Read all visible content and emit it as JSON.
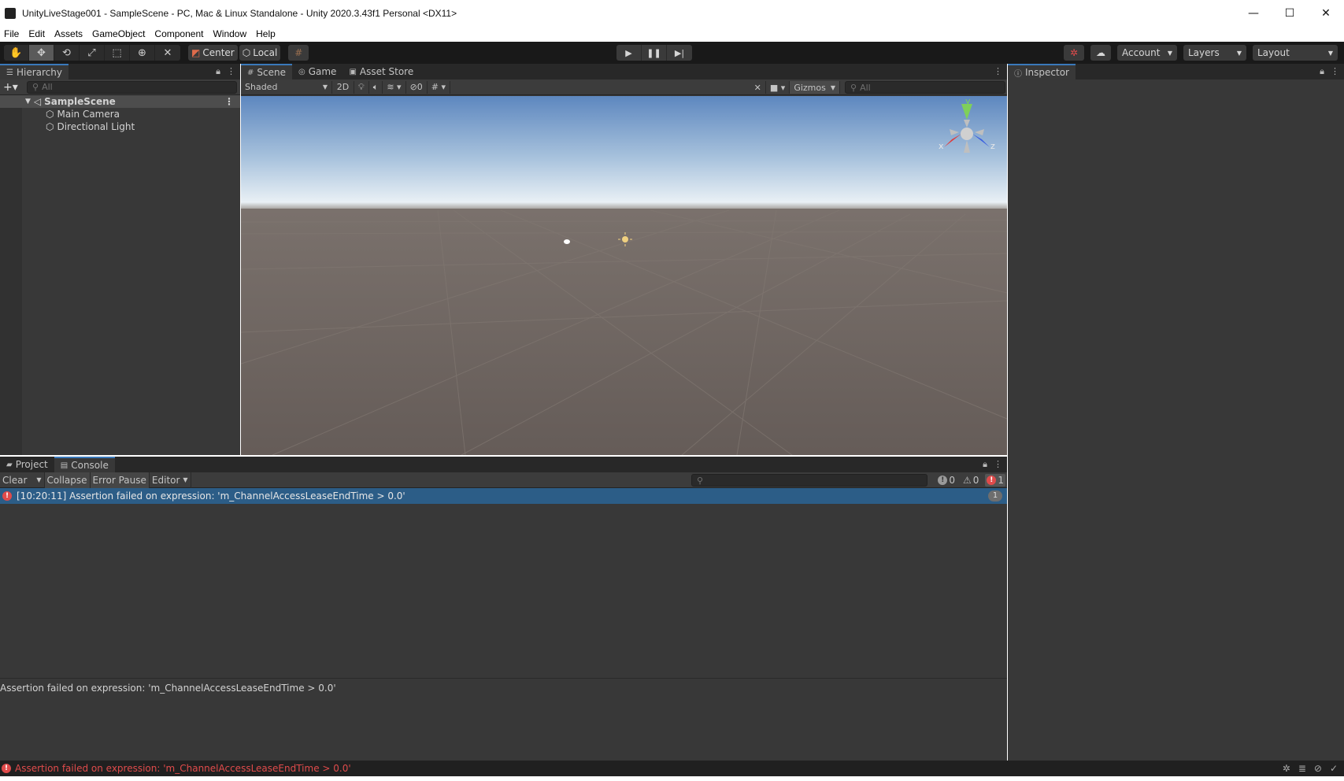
{
  "window": {
    "title": "UnityLiveStage001 - SampleScene - PC, Mac & Linux Standalone - Unity 2020.3.43f1 Personal <DX11>",
    "controls": [
      "—",
      "☐",
      "✕"
    ]
  },
  "menu": [
    "File",
    "Edit",
    "Assets",
    "GameObject",
    "Component",
    "Window",
    "Help"
  ],
  "toolbar": {
    "pivot_label": "Center",
    "space_label": "Local",
    "account_label": "Account",
    "layers_label": "Layers",
    "layout_label": "Layout"
  },
  "hierarchy": {
    "tab_label": "Hierarchy",
    "search_placeholder": "All",
    "scene_name": "SampleScene",
    "objects": [
      "Main Camera",
      "Directional Light"
    ]
  },
  "scene": {
    "tabs": [
      "Scene",
      "Game",
      "Asset Store"
    ],
    "shading": "Shaded",
    "mode_2d": "2D",
    "hidden_count": "0",
    "gizmos_label": "Gizmos",
    "search_placeholder": "All",
    "axes": {
      "y": "y",
      "x": "x",
      "z": "z"
    },
    "colors": {
      "sky_top": "#5d87bf",
      "sky_horizon": "#dfe8f0",
      "ground": "#6b625e"
    }
  },
  "inspector": {
    "tab_label": "Inspector"
  },
  "console": {
    "tabs": [
      "Project",
      "Console"
    ],
    "buttons": [
      "Clear",
      "Collapse",
      "Error Pause",
      "Editor"
    ],
    "counts": {
      "info": "0",
      "warning": "0",
      "error": "1"
    },
    "entry": {
      "text": "[10:20:11] Assertion failed on expression: 'm_ChannelAccessLeaseEndTime > 0.0'",
      "count": "1"
    },
    "detail": "Assertion failed on expression: 'm_ChannelAccessLeaseEndTime > 0.0'"
  },
  "statusbar": {
    "message": "Assertion failed on expression: 'm_ChannelAccessLeaseEndTime > 0.0'"
  }
}
